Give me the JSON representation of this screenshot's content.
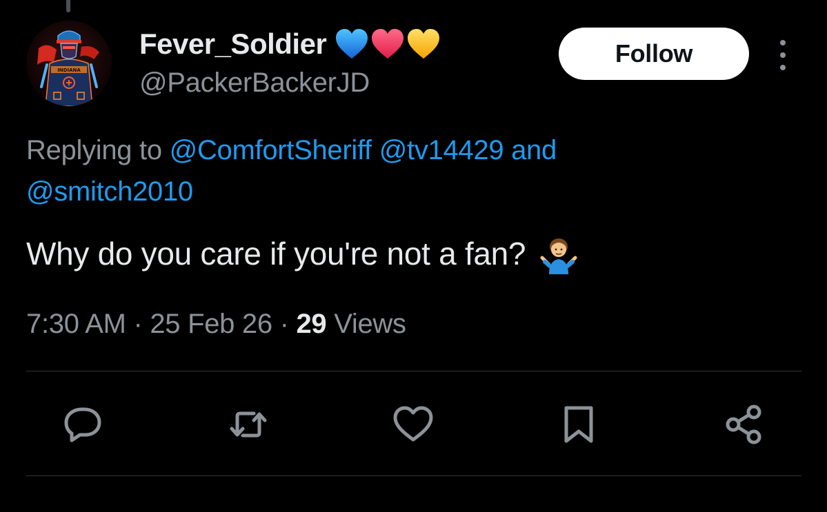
{
  "user": {
    "display_name": "Fever_Soldier",
    "handle": "@PackerBackerJD",
    "name_emojis": [
      "blue-heart",
      "red-heart",
      "yellow-heart"
    ],
    "avatar_text": "INDIANA"
  },
  "follow_button": {
    "label": "Follow"
  },
  "reply_context": {
    "prefix": "Replying to ",
    "mention_1": "@ComfortSheriff",
    "mention_2": "@tv14429",
    "conjunction": " and",
    "mention_3": "@smitch2010"
  },
  "tweet": {
    "text": "Why do you care if you're not a fan?",
    "emoji": "person-shrugging"
  },
  "meta": {
    "time": "7:30 AM",
    "separator": "·",
    "date": "25 Feb 26",
    "views_count": "29",
    "views_label": "Views"
  },
  "actions": [
    {
      "name": "reply",
      "icon": "comment-icon"
    },
    {
      "name": "repost",
      "icon": "repost-icon"
    },
    {
      "name": "like",
      "icon": "heart-icon"
    },
    {
      "name": "bookmark",
      "icon": "bookmark-icon"
    },
    {
      "name": "share",
      "icon": "share-icon"
    }
  ],
  "colors": {
    "background": "#000000",
    "text_primary": "#e7e9ea",
    "text_secondary": "#8b9298",
    "link": "#1d9bf0",
    "divider": "#2f3336",
    "follow_bg": "#ffffff"
  }
}
